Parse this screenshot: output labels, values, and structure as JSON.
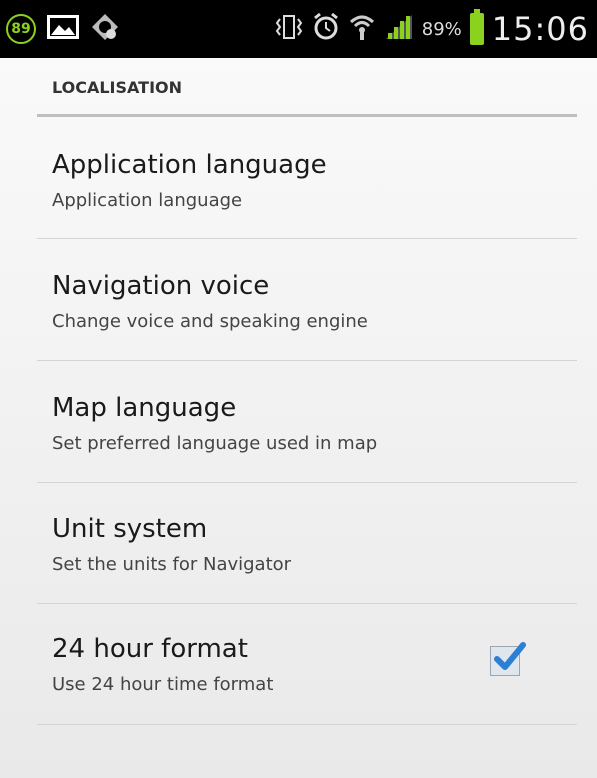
{
  "statusbar": {
    "notification_count": "89",
    "battery_percent": "89%",
    "time": "15:06",
    "icons": [
      "notification-count-icon",
      "image-icon",
      "vpn-icon",
      "vibrate-icon",
      "alarm-icon",
      "wifi-icon",
      "signal-icon",
      "battery-icon"
    ],
    "accent_color": "#8bd21f"
  },
  "settings": {
    "section_header": "LOCALISATION",
    "items": [
      {
        "title": "Application language",
        "summary": "Application language"
      },
      {
        "title": "Navigation voice",
        "summary": "Change voice and speaking engine"
      },
      {
        "title": "Map language",
        "summary": "Set preferred language used in map"
      },
      {
        "title": "Unit system",
        "summary": "Set the units for Navigator"
      },
      {
        "title": "24 hour format",
        "summary": "Use 24 hour time format",
        "checked": true
      }
    ]
  },
  "checkbox": {
    "accent_color": "#2d7fd3"
  }
}
